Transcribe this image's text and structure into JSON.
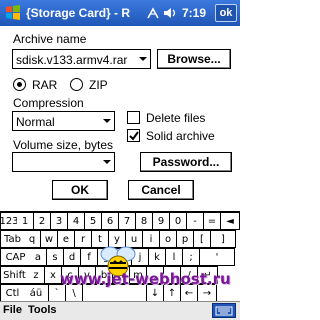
{
  "window": {
    "title": "{Storage Card} - R",
    "time": "7:19",
    "ok_label": "ok",
    "icons": [
      "windows-logo-icon",
      "connectivity-icon",
      "volume-icon"
    ]
  },
  "form": {
    "archive_name_label": "Archive name",
    "archive_name_value": "sdisk.v133.armv4.rar",
    "browse_label": "Browse...",
    "format_rar_label": "RAR",
    "format_zip_label": "ZIP",
    "format_selected": "RAR",
    "compression_label": "Compression",
    "compression_value": "Normal",
    "delete_files_label": "Delete files",
    "delete_files_checked": false,
    "solid_archive_label": "Solid archive",
    "solid_archive_checked": true,
    "volume_size_label": "Volume size, bytes",
    "volume_size_value": "",
    "password_label": "Password...",
    "ok_label": "OK",
    "cancel_label": "Cancel"
  },
  "keyboard": {
    "rows": [
      [
        "123",
        "1",
        "2",
        "3",
        "4",
        "5",
        "6",
        "7",
        "8",
        "9",
        "0",
        "-",
        "=",
        "◄"
      ],
      [
        "Tab",
        "q",
        "w",
        "e",
        "r",
        "t",
        "y",
        "u",
        "i",
        "o",
        "p",
        "[",
        "]"
      ],
      [
        "CAP",
        "a",
        "s",
        "d",
        "f",
        "g",
        "h",
        "j",
        "k",
        "l",
        ";",
        "'"
      ],
      [
        "Shift",
        "z",
        "x",
        "c",
        "v",
        "b",
        "n",
        "m",
        ",",
        ".",
        "/",
        "↵"
      ],
      [
        "Ctl",
        "áü",
        "`",
        "\\",
        "",
        "↓",
        "↑",
        "←",
        "→"
      ]
    ]
  },
  "menubar": {
    "file_label": "File",
    "tools_label": "Tools"
  },
  "watermark": {
    "text": "www.jet-webhost.ru"
  }
}
